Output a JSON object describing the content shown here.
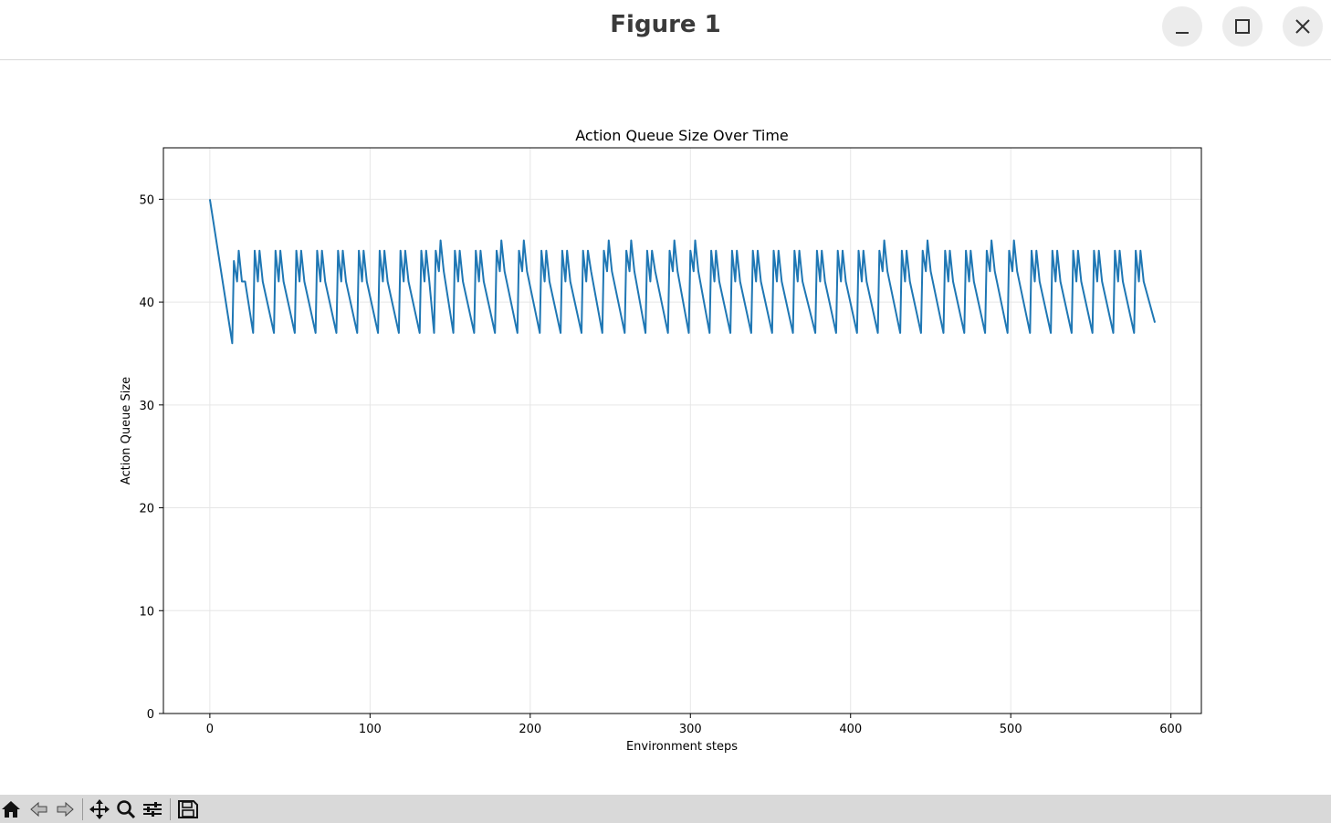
{
  "window": {
    "title": "Figure 1",
    "buttons": {
      "minimize": "minimize-icon",
      "maximize": "maximize-icon",
      "close": "close-icon"
    }
  },
  "toolbar": {
    "items": [
      "home-icon",
      "back-arrow-icon",
      "forward-arrow-icon",
      "pan-icon",
      "zoom-icon",
      "configure-subplots-icon",
      "save-icon"
    ]
  },
  "chart_data": {
    "type": "line",
    "title": "Action Queue Size Over Time",
    "xlabel": "Environment steps",
    "ylabel": "Action Queue Size",
    "xlim": [
      -29,
      619
    ],
    "ylim": [
      0,
      55
    ],
    "xticks": [
      0,
      100,
      200,
      300,
      400,
      500,
      600
    ],
    "yticks": [
      0,
      10,
      20,
      30,
      40,
      50
    ],
    "grid": true,
    "series": [
      {
        "color": "#1f77b4",
        "x": [
          0,
          14,
          15,
          17,
          18,
          20,
          21,
          22,
          27,
          28,
          30,
          31,
          33,
          40,
          41,
          43,
          44,
          46,
          53,
          54,
          56,
          57,
          59,
          66,
          67,
          69,
          70,
          72,
          79,
          80,
          82,
          83,
          85,
          92,
          93,
          95,
          96,
          98,
          105,
          106,
          108,
          109,
          111,
          118,
          119,
          121,
          122,
          124,
          131,
          132,
          134,
          135,
          137,
          140,
          141,
          143,
          144,
          146,
          152,
          153,
          155,
          156,
          158,
          165,
          166,
          168,
          169,
          171,
          178,
          179,
          181,
          182,
          184,
          192,
          193,
          195,
          196,
          198,
          206,
          207,
          209,
          210,
          212,
          219,
          220,
          222,
          223,
          225,
          232,
          233,
          235,
          236,
          238,
          245,
          246,
          248,
          249,
          251,
          259,
          260,
          262,
          263,
          265,
          272,
          273,
          275,
          276,
          278,
          286,
          287,
          289,
          290,
          292,
          299,
          300,
          302,
          303,
          305,
          312,
          313,
          315,
          316,
          318,
          325,
          326,
          328,
          329,
          331,
          338,
          339,
          341,
          342,
          344,
          351,
          352,
          354,
          355,
          357,
          364,
          365,
          367,
          368,
          370,
          378,
          379,
          381,
          382,
          384,
          391,
          392,
          394,
          395,
          397,
          404,
          405,
          407,
          408,
          410,
          417,
          418,
          420,
          421,
          423,
          431,
          432,
          434,
          435,
          437,
          444,
          445,
          447,
          448,
          450,
          458,
          459,
          461,
          462,
          464,
          471,
          472,
          474,
          475,
          477,
          484,
          485,
          487,
          488,
          490,
          498,
          499,
          501,
          502,
          504,
          512,
          513,
          515,
          516,
          518,
          525,
          526,
          528,
          529,
          531,
          538,
          539,
          541,
          542,
          544,
          551,
          552,
          554,
          555,
          557,
          564,
          565,
          567,
          568,
          570,
          577,
          578,
          580,
          581,
          583,
          590
        ],
        "y": [
          50,
          36,
          44,
          42,
          45,
          42,
          42,
          42,
          37,
          45,
          42,
          45,
          42,
          37,
          45,
          42,
          45,
          42,
          37,
          45,
          42,
          45,
          42,
          37,
          45,
          42,
          45,
          42,
          37,
          45,
          42,
          45,
          42,
          37,
          45,
          42,
          45,
          42,
          37,
          45,
          42,
          45,
          42,
          37,
          45,
          42,
          45,
          42,
          37,
          45,
          42,
          45,
          42,
          37,
          45,
          43,
          46,
          43,
          37,
          45,
          42,
          45,
          42,
          37,
          45,
          42,
          45,
          42,
          37,
          45,
          43,
          46,
          43,
          37,
          45,
          43,
          46,
          43,
          37,
          45,
          42,
          45,
          42,
          37,
          45,
          42,
          45,
          42,
          37,
          45,
          42,
          45,
          43,
          37,
          45,
          43,
          46,
          43,
          37,
          45,
          43,
          46,
          43,
          37,
          45,
          42,
          45,
          43,
          37,
          45,
          43,
          46,
          43,
          37,
          45,
          43,
          46,
          43,
          37,
          45,
          42,
          45,
          42,
          37,
          45,
          42,
          45,
          42,
          37,
          45,
          42,
          45,
          42,
          37,
          45,
          42,
          45,
          42,
          37,
          45,
          42,
          45,
          42,
          37,
          45,
          42,
          45,
          42,
          37,
          45,
          42,
          45,
          42,
          37,
          45,
          42,
          45,
          42,
          37,
          45,
          43,
          46,
          43,
          37,
          45,
          42,
          45,
          42,
          37,
          45,
          43,
          46,
          43,
          37,
          45,
          42,
          45,
          42,
          37,
          45,
          42,
          45,
          42,
          37,
          45,
          43,
          46,
          43,
          37,
          45,
          43,
          46,
          43,
          37,
          45,
          42,
          45,
          42,
          37,
          45,
          42,
          45,
          42,
          37,
          45,
          42,
          45,
          42,
          37,
          45,
          42,
          45,
          42,
          37,
          45,
          42,
          45,
          42,
          37,
          45,
          42,
          45,
          42,
          38
        ]
      }
    ]
  }
}
